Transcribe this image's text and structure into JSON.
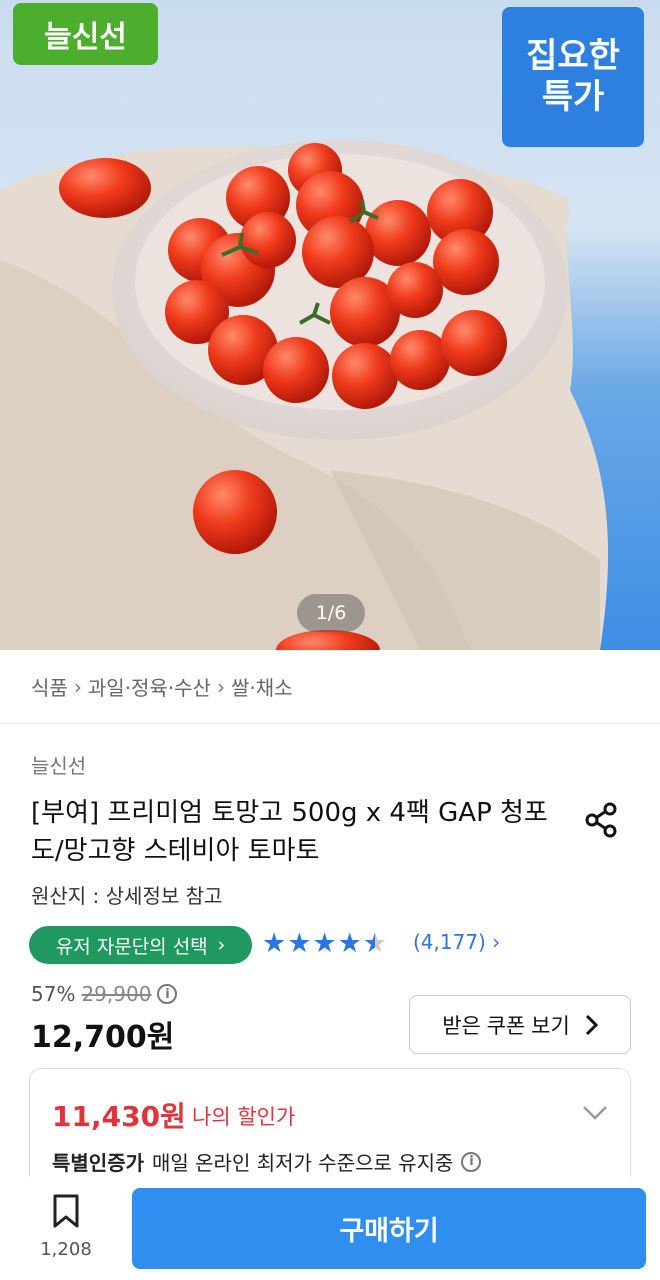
{
  "hero": {
    "badge_left": "늘신선",
    "badge_right_line1": "집요한",
    "badge_right_line2": "특가",
    "page_indicator": "1/6"
  },
  "breadcrumb": [
    "식품",
    "과일·정육·수산",
    "쌀·채소"
  ],
  "product": {
    "store": "늘신선",
    "title": "[부여] 프리미엄 토망고 500g x 4팩 GAP 청포도/망고향 스테비아 토마토",
    "origin": "원산지 : 상세정보 참고",
    "pill_label": "유저 자문단의 선택",
    "rating_stars": 4.5,
    "review_count": "(4,177)",
    "discount_rate": "57%",
    "original_price": "29,900",
    "price": "12,700원",
    "coupon_button": "받은 쿠폰 보기"
  },
  "my_discount": {
    "price": "11,430원",
    "label": "나의 할인가",
    "special_bold": "특별인증가",
    "special_text": "매일 온라인 최저가 수준으로 유지중"
  },
  "bottom": {
    "bookmark_count": "1,208",
    "buy_label": "구매하기"
  },
  "colors": {
    "badge_green": "#4cae2c",
    "badge_blue": "#2d7fe0",
    "pill_green": "#1f9960",
    "star_blue": "#2b76e5",
    "discount_red": "#e0333b",
    "buy_blue": "#2f8ef0"
  },
  "icons": [
    "share-icon",
    "info-icon",
    "chevron-right-icon",
    "chevron-down-icon",
    "bookmark-icon",
    "star-icon"
  ]
}
